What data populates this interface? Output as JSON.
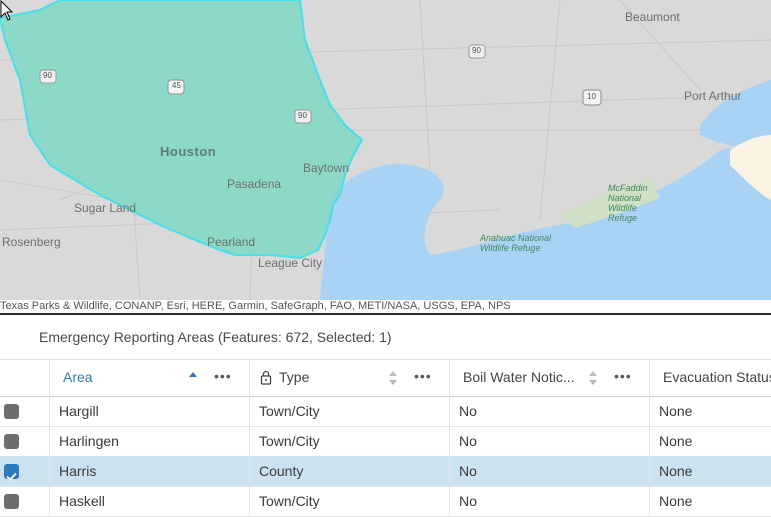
{
  "map": {
    "labels": {
      "beaumont": "Beaumont",
      "port_arthur": "Port Arthur",
      "houston": "Houston",
      "baytown": "Baytown",
      "pasadena": "Pasadena",
      "sugar_land": "Sugar Land",
      "rosenberg": "Rosenberg",
      "pearland": "Pearland",
      "league_city": "League City",
      "mcfaddin": "McFaddin\nNational\nWildlife\nRefuge",
      "anahuac": "Anahuac National\nWildlife Refuge"
    },
    "highway_shields": {
      "i10_east": "10",
      "i45": "45",
      "us90_left": "90",
      "us90_mid": "90",
      "us90_east": "90"
    },
    "attribution": "Texas Parks & Wildlife, CONANP, Esri, HERE, Garmin, SafeGraph, FAO, METI/NASA, USGS, EPA, NPS",
    "colors": {
      "land": "#d9d9d7",
      "water": "#a9d3f5",
      "highlight_fill": "#7fd8c6",
      "highlight_stroke": "#45e0ea"
    }
  },
  "table": {
    "title": "Emergency Reporting Areas (Features: 672, Selected: 1)",
    "columns": [
      {
        "label": "Area",
        "sorted": "ascending"
      },
      {
        "label": "Type",
        "locked": true
      },
      {
        "label": "Boil Water Notic..."
      },
      {
        "label": "Evacuation Status"
      }
    ],
    "more_label": "•••",
    "rows": [
      {
        "area": "Hargill",
        "type": "Town/City",
        "boil": "No",
        "evac": "None",
        "selected": false
      },
      {
        "area": "Harlingen",
        "type": "Town/City",
        "boil": "No",
        "evac": "None",
        "selected": false
      },
      {
        "area": "Harris",
        "type": "County",
        "boil": "No",
        "evac": "None",
        "selected": true
      },
      {
        "area": "Haskell",
        "type": "Town/City",
        "boil": "No",
        "evac": "None",
        "selected": false
      }
    ]
  }
}
